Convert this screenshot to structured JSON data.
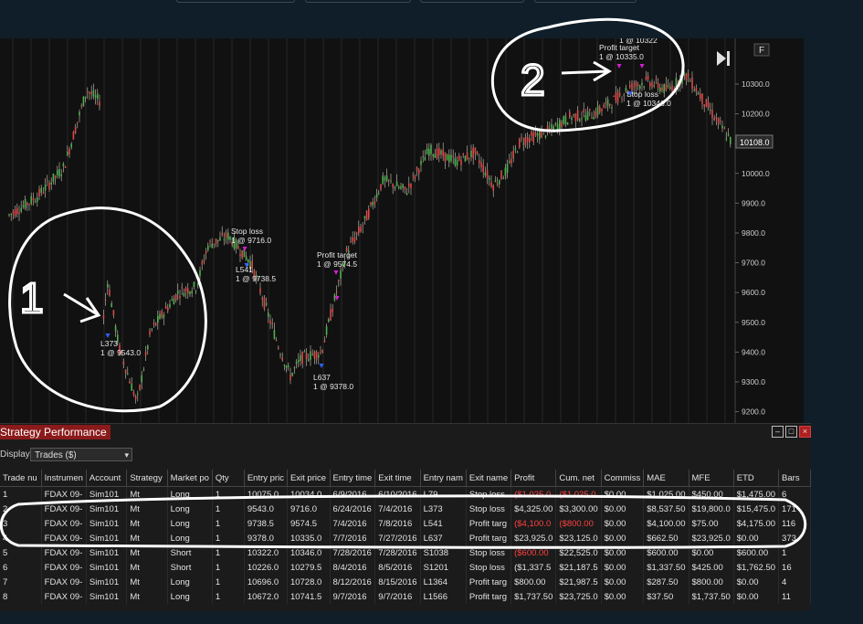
{
  "chart": {
    "price_ticks": [
      "10300.0",
      "10200.0",
      "10100.0",
      "10000.0",
      "9900.0",
      "9800.0",
      "9700.0",
      "9600.0",
      "9500.0",
      "9400.0",
      "9300.0",
      "9200.0"
    ],
    "current_price": "10108.0",
    "f_button": "F",
    "play_icon": "play-skip-icon",
    "markers": [
      {
        "lines": [
          "Stop loss",
          "1 @ 9716.0"
        ]
      },
      {
        "lines": [
          "L541",
          "1 @ 9738.5"
        ]
      },
      {
        "lines": [
          "Profit target",
          "1 @ 9574.5"
        ]
      },
      {
        "lines": [
          "L373",
          "1 @ 9543.0"
        ]
      },
      {
        "lines": [
          "L637",
          "1 @ 9378.0"
        ]
      },
      {
        "lines": [
          "Profit target",
          "1 @ 10335.0"
        ]
      },
      {
        "lines": [
          "1 @ 10322"
        ]
      },
      {
        "lines": [
          "Stop loss",
          "1 @ 10346.0"
        ]
      }
    ],
    "colors": {
      "up": "#4fae4f",
      "down": "#d94848",
      "wick": "#d0c8b8",
      "bg": "#111111",
      "grid": "#262626"
    }
  },
  "annotations": {
    "label1": "1",
    "label2": "2"
  },
  "panel": {
    "title": "Strategy Performance",
    "display_label": "Display",
    "display_value": "Trades ($)"
  },
  "table": {
    "headers": [
      "Trade nu",
      "Instrumen",
      "Account",
      "Strategy",
      "Market po",
      "Qty",
      "Entry pric",
      "Exit price",
      "Entry time",
      "Exit time",
      "Entry nam",
      "Exit name",
      "Profit",
      "Cum. net",
      "Commiss",
      "MAE",
      "MFE",
      "ETD",
      "Bars"
    ],
    "rows": [
      [
        "1",
        "FDAX 09-",
        "Sim101",
        "Mt",
        "Long",
        "1",
        "10075.0",
        "10034.0",
        "6/9/2016",
        "6/10/2016",
        "L79",
        "Stop loss",
        "($1,025.0",
        "($1,025.0",
        "$0.00",
        "$1,025.00",
        "$450.00",
        "$1,475.00",
        "6"
      ],
      [
        "2",
        "FDAX 09-",
        "Sim101",
        "Mt",
        "Long",
        "1",
        "9543.0",
        "9716.0",
        "6/24/2016",
        "7/4/2016",
        "L373",
        "Stop loss",
        "$4,325.00",
        "$3,300.00",
        "$0.00",
        "$8,537.50",
        "$19,800.0",
        "$15,475.0",
        "171"
      ],
      [
        "3",
        "FDAX 09-",
        "Sim101",
        "Mt",
        "Long",
        "1",
        "9738.5",
        "9574.5",
        "7/4/2016",
        "7/8/2016",
        "L541",
        "Profit targ",
        "($4,100.0",
        "($800.00",
        "$0.00",
        "$4,100.00",
        "$75.00",
        "$4,175.00",
        "116"
      ],
      [
        "4",
        "FDAX 09-",
        "Sim101",
        "Mt",
        "Long",
        "1",
        "9378.0",
        "10335.0",
        "7/7/2016",
        "7/27/2016",
        "L637",
        "Profit targ",
        "$23,925.0",
        "$23,125.0",
        "$0.00",
        "$662.50",
        "$23,925.0",
        "$0.00",
        "373"
      ],
      [
        "5",
        "FDAX 09-",
        "Sim101",
        "Mt",
        "Short",
        "1",
        "10322.0",
        "10346.0",
        "7/28/2016",
        "7/28/2016",
        "S1038",
        "Stop loss",
        "($600.00",
        "$22,525.0",
        "$0.00",
        "$600.00",
        "$0.00",
        "$600.00",
        "1"
      ],
      [
        "6",
        "FDAX 09-",
        "Sim101",
        "Mt",
        "Short",
        "1",
        "10226.0",
        "10279.5",
        "8/4/2016",
        "8/5/2016",
        "S1201",
        "Stop loss",
        "($1,337.5",
        "$21,187.5",
        "$0.00",
        "$1,337.50",
        "$425.00",
        "$1,762.50",
        "16"
      ],
      [
        "7",
        "FDAX 09-",
        "Sim101",
        "Mt",
        "Long",
        "1",
        "10696.0",
        "10728.0",
        "8/12/2016",
        "8/15/2016",
        "L1364",
        "Profit targ",
        "$800.00",
        "$21,987.5",
        "$0.00",
        "$287.50",
        "$800.00",
        "$0.00",
        "4"
      ],
      [
        "8",
        "FDAX 09-",
        "Sim101",
        "Mt",
        "Long",
        "1",
        "10672.0",
        "10741.5",
        "9/7/2016",
        "9/7/2016",
        "L1566",
        "Profit targ",
        "$1,737.50",
        "$23,725.0",
        "$0.00",
        "$37.50",
        "$1,737.50",
        "$0.00",
        "11"
      ]
    ],
    "negative_cells": [
      [
        0,
        12
      ],
      [
        0,
        13
      ],
      [
        2,
        12
      ],
      [
        2,
        13
      ],
      [
        4,
        12
      ]
    ]
  }
}
